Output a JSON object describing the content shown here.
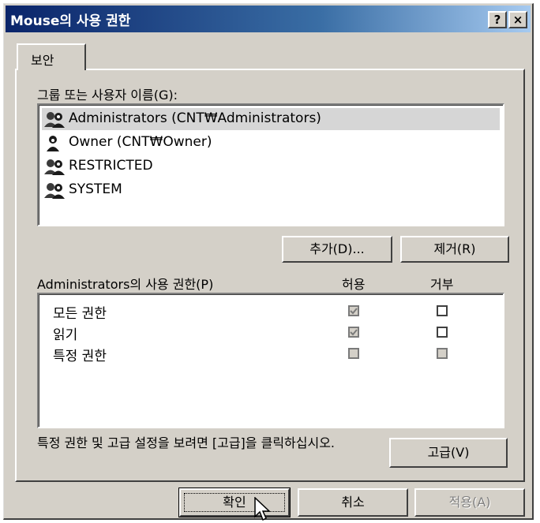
{
  "window": {
    "title": "Mouse의 사용 권한",
    "help_button": "?",
    "close_button": "×"
  },
  "tab": {
    "label": "보안"
  },
  "users_section": {
    "label": "그룹 또는 사용자 이름(G):",
    "users": [
      {
        "name": "Administrators (CNT₩Administrators)",
        "icon": "group-icon",
        "selected": true
      },
      {
        "name": "Owner (CNT₩Owner)",
        "icon": "user-icon",
        "selected": false
      },
      {
        "name": "RESTRICTED",
        "icon": "group-icon",
        "selected": false
      },
      {
        "name": "SYSTEM",
        "icon": "group-icon",
        "selected": false
      }
    ],
    "add_button": "추가(D)...",
    "remove_button": "제거(R)"
  },
  "permissions_section": {
    "label": "Administrators의 사용 권한(P)",
    "allow_header": "허용",
    "deny_header": "거부",
    "rows": [
      {
        "name": "모든 권한",
        "allow": true,
        "allow_disabled": true,
        "deny": false,
        "deny_disabled": false
      },
      {
        "name": "읽기",
        "allow": true,
        "allow_disabled": true,
        "deny": false,
        "deny_disabled": false
      },
      {
        "name": "특정 권한",
        "allow": false,
        "allow_disabled": true,
        "deny": false,
        "deny_disabled": true
      }
    ]
  },
  "advanced": {
    "hint": "특정 권한 및 고급 설정을 보려면 [고급]을 클릭하십시오.",
    "button": "고급(V)"
  },
  "footer": {
    "ok": "확인",
    "cancel": "취소",
    "apply": "적용(A)"
  }
}
